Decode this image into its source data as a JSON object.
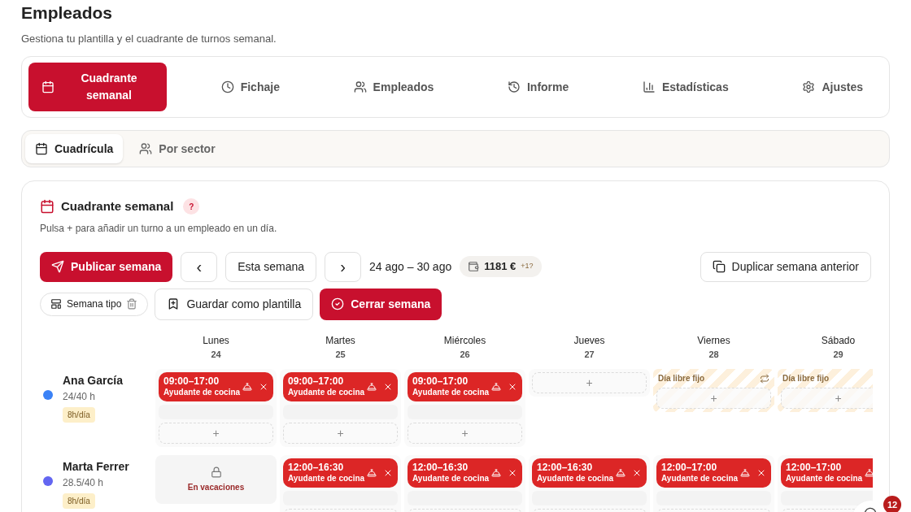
{
  "page": {
    "title": "Empleados",
    "subtitle": "Gestiona tu plantilla y el cuadrante de turnos semanal."
  },
  "tabs": [
    {
      "label": "Cuadrante semanal",
      "selected": true
    },
    {
      "label": "Fichaje",
      "selected": false
    },
    {
      "label": "Empleados",
      "selected": false
    },
    {
      "label": "Informe",
      "selected": false
    },
    {
      "label": "Estadísticas",
      "selected": false
    },
    {
      "label": "Ajustes",
      "selected": false
    }
  ],
  "view_tabs": [
    {
      "label": "Cuadrícula",
      "selected": true
    },
    {
      "label": "Por sector",
      "selected": false
    }
  ],
  "schedule": {
    "title": "Cuadrante semanal",
    "help": "?",
    "hint": "Pulsa + para añadir un turno a un empleado en un día.",
    "publish": "Publicar semana",
    "prev": "‹",
    "current": "Esta semana",
    "next": "›",
    "range": "24 ago – 30 ago",
    "cost": "1181 €",
    "cost_extra": "+1?",
    "duplicate": "Duplicar semana anterior",
    "template_chip": "Semana tipo",
    "save_template": "Guardar como plantilla",
    "close_week": "Cerrar semana",
    "add": "+",
    "days": [
      {
        "name": "Lunes",
        "date": "24"
      },
      {
        "name": "Martes",
        "date": "25"
      },
      {
        "name": "Miércoles",
        "date": "26"
      },
      {
        "name": "Jueves",
        "date": "27"
      },
      {
        "name": "Viernes",
        "date": "28"
      },
      {
        "name": "Sábado",
        "date": "29"
      }
    ],
    "employees": [
      {
        "name": "Ana García",
        "hours": "24/40 h",
        "per_day": "8h/día",
        "color": "#3b82f6",
        "cells": [
          {
            "kind": "shift",
            "time": "09:00–17:00",
            "role": "Ayudante de cocina"
          },
          {
            "kind": "shift",
            "time": "09:00–17:00",
            "role": "Ayudante de cocina"
          },
          {
            "kind": "shift",
            "time": "09:00–17:00",
            "role": "Ayudante de cocina"
          },
          {
            "kind": "empty"
          },
          {
            "kind": "day_off",
            "label": "Día libre fijo",
            "swap": true
          },
          {
            "kind": "day_off",
            "label": "Día libre fijo"
          }
        ]
      },
      {
        "name": "Marta Ferrer",
        "hours": "28.5/40 h",
        "per_day": "8h/día",
        "color": "#6366f1",
        "cells": [
          {
            "kind": "vacation",
            "label": "En vacaciones"
          },
          {
            "kind": "shift",
            "time": "12:00–16:30",
            "role": "Ayudante de cocina"
          },
          {
            "kind": "shift",
            "time": "12:00–16:30",
            "role": "Ayudante de cocina"
          },
          {
            "kind": "shift",
            "time": "12:00–16:30",
            "role": "Ayudante de cocina"
          },
          {
            "kind": "shift",
            "time": "12:00–17:00",
            "role": "Ayudante de cocina"
          },
          {
            "kind": "shift",
            "time": "12:00–17:00",
            "role": "Ayudante de cocina"
          }
        ]
      }
    ]
  },
  "floating_button": {
    "badge": "12"
  }
}
